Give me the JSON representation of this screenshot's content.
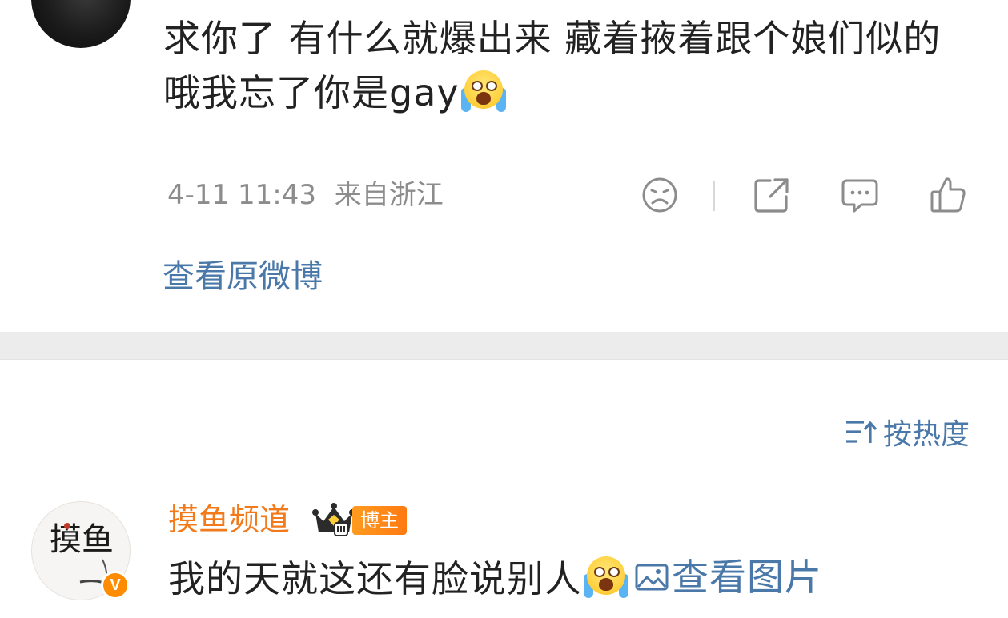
{
  "top_comment": {
    "text": "求你了 有什么就爆出来 藏着掖着跟个娘们似的 哦我忘了你是gay",
    "emoji": "loudly-crying-emoji",
    "timestamp": "4-11 11:43",
    "location": "来自浙江",
    "actions": [
      "dislike-face-icon",
      "share-icon",
      "comment-icon",
      "like-icon"
    ],
    "view_original": "查看原微博"
  },
  "sort": {
    "label": "按热度",
    "icon": "sort-icon"
  },
  "second_comment": {
    "username": "摸鱼频道",
    "badge_icon": "crown-level-icon",
    "author_tag": "博主",
    "verified_mark": "V",
    "text": "我的天就这还有脸说别人",
    "emoji": "loudly-crying-emoji",
    "image_link": "查看图片",
    "avatar_text": "摸鱼"
  },
  "colors": {
    "link": "#4a78a8",
    "username": "#f27a1a",
    "text": "#222222",
    "meta": "#8c8c8c",
    "divider": "#ececec"
  }
}
